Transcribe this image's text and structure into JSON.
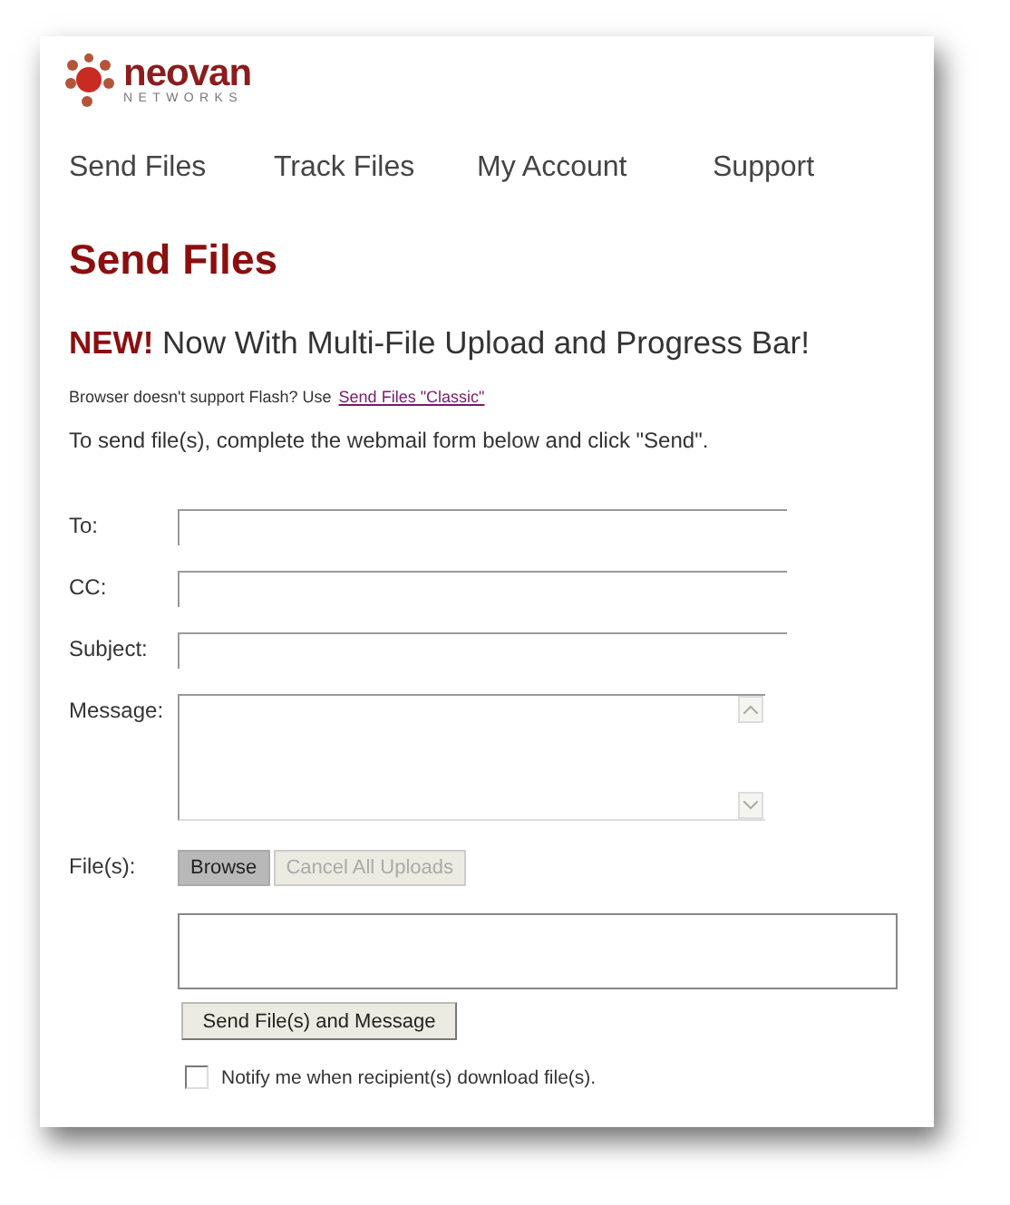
{
  "logo": {
    "name": "neovan",
    "tagline": "NETWORKS"
  },
  "nav": [
    {
      "label": "Send Files"
    },
    {
      "label": "Track Files"
    },
    {
      "label": "My Account"
    },
    {
      "label": "Support"
    }
  ],
  "title": "Send Files",
  "announcement": {
    "badge": "NEW!",
    "text": "Now With Multi-File Upload and Progress Bar!"
  },
  "flash_note": {
    "text": "Browser doesn't support Flash? Use",
    "link": "Send Files \"Classic\""
  },
  "instructions": "To send file(s), complete the webmail form below and click \"Send\".",
  "fields": [
    {
      "label": "To:",
      "kind": "input"
    },
    {
      "label": "CC:",
      "kind": "input"
    },
    {
      "label": "Subject:",
      "kind": "input"
    },
    {
      "label": "Message:",
      "kind": "textarea"
    }
  ],
  "files": {
    "label": "File(s):",
    "buttons": [
      {
        "label": "Browse",
        "disabled": false
      },
      {
        "label": "Cancel All Uploads",
        "disabled": true
      }
    ]
  },
  "submit": "Send File(s) and Message",
  "notify": {
    "label": "Notify me when recipient(s) download file(s).",
    "checked": false
  }
}
